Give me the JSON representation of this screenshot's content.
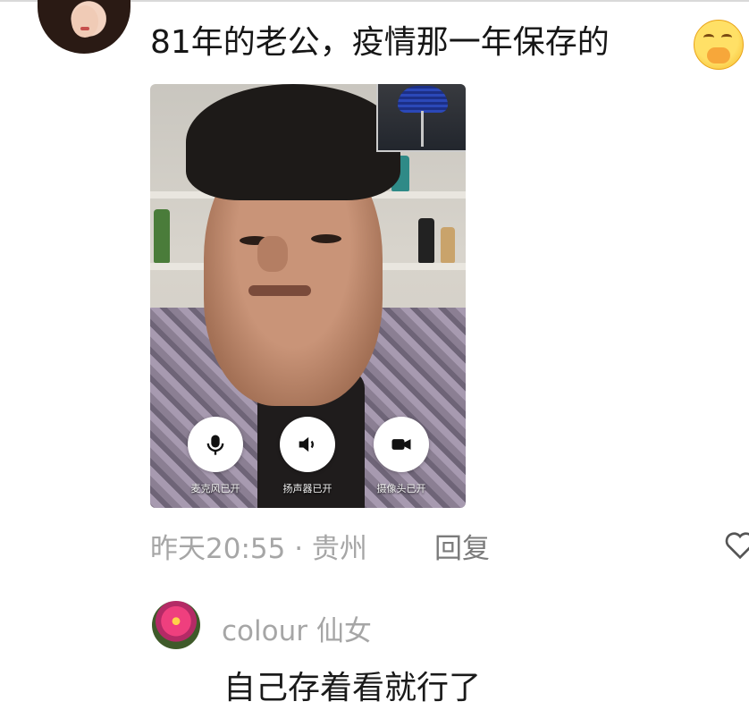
{
  "comment": {
    "text": "81年的老公，疫情那一年保存的",
    "emoji": "smiling-face-with-hand-over-mouth-emoji",
    "time_location": "昨天20:55 · 贵州",
    "reply_label": "回复"
  },
  "video_call": {
    "controls": [
      {
        "icon": "microphone-icon",
        "label": "麦克风已开"
      },
      {
        "icon": "speaker-icon",
        "label": "扬声器已开"
      },
      {
        "icon": "camera-icon",
        "label": "摄像头已开"
      }
    ]
  },
  "reply": {
    "username": "colour 仙女",
    "text": "自己存着看就行了"
  },
  "colors": {
    "meta_gray": "#a6a6a6",
    "text_dark": "#1a1a1a"
  }
}
